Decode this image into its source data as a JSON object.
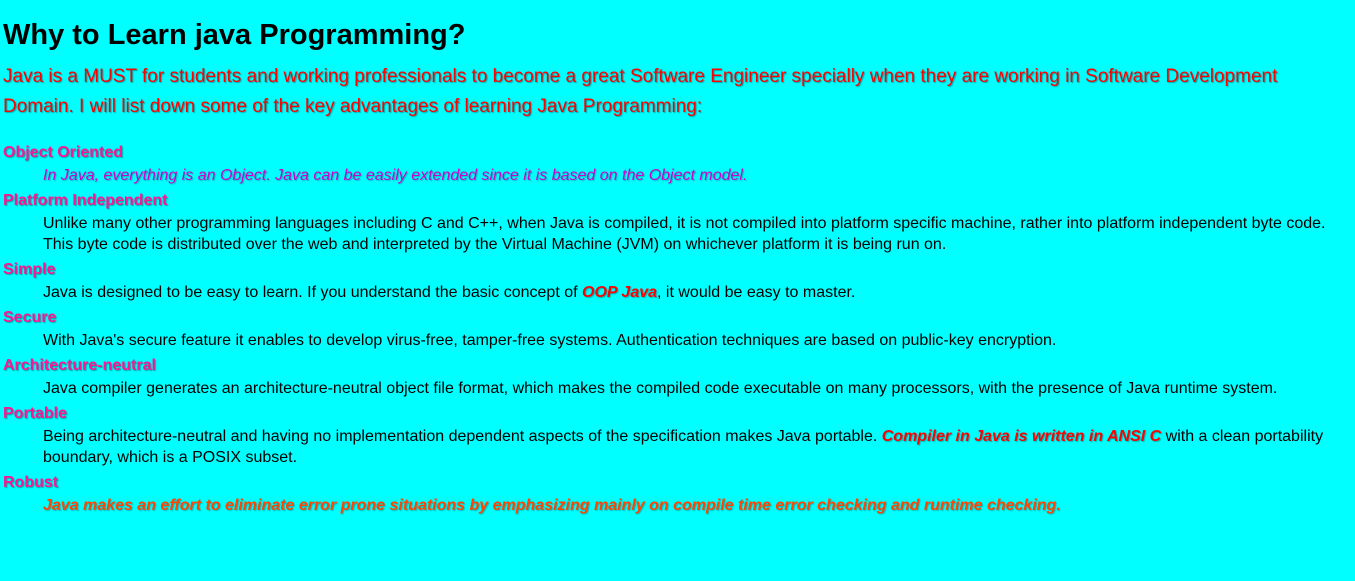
{
  "title": "Why to Learn java Programming?",
  "intro": "Java is a MUST for students and working professionals to become a great Software Engineer specially when they are working in Software Development Domain. I will list down some of the key advantages of learning Java Programming:",
  "items": [
    {
      "term": "Object Oriented",
      "desc": "In Java, everything is an Object. Java can be easily extended since it is based on the Object model."
    },
    {
      "term": "Platform Independent",
      "desc": "Unlike many other programming languages including C and C++, when Java is compiled, it is not compiled into platform specific machine, rather into platform independent byte code. This byte code is distributed over the web and interpreted by the Virtual Machine (JVM) on whichever platform it is being run on."
    },
    {
      "term": "Simple",
      "desc_before": "Java is designed to be easy to learn. If you understand the basic concept of ",
      "desc_emphasis": "OOP Java",
      "desc_after": ", it would be easy to master."
    },
    {
      "term": "Secure",
      "desc": "With Java's secure feature it enables to develop virus-free, tamper-free systems. Authentication techniques are based on public-key encryption."
    },
    {
      "term": "Architecture-neutral",
      "desc": "Java compiler generates an architecture-neutral object file format, which makes the compiled code executable on many processors, with the presence of Java runtime system."
    },
    {
      "term": "Portable",
      "desc_before": "Being architecture-neutral and having no implementation dependent aspects of the specification makes Java portable. ",
      "desc_emphasis": "Compiler in Java is written in ANSI C",
      "desc_after": " with a clean portability boundary, which is a POSIX subset."
    },
    {
      "term": "Robust",
      "desc": "Java makes an effort to eliminate error prone situations by emphasizing mainly on compile time error checking and runtime checking."
    }
  ],
  "colors": {
    "background": "#00ffff",
    "intro_text": "#ff0000",
    "term_text": "#ff1493",
    "first_desc": "#cc00cc",
    "last_desc": "#ff4500",
    "emphasis": "#ff0000"
  }
}
